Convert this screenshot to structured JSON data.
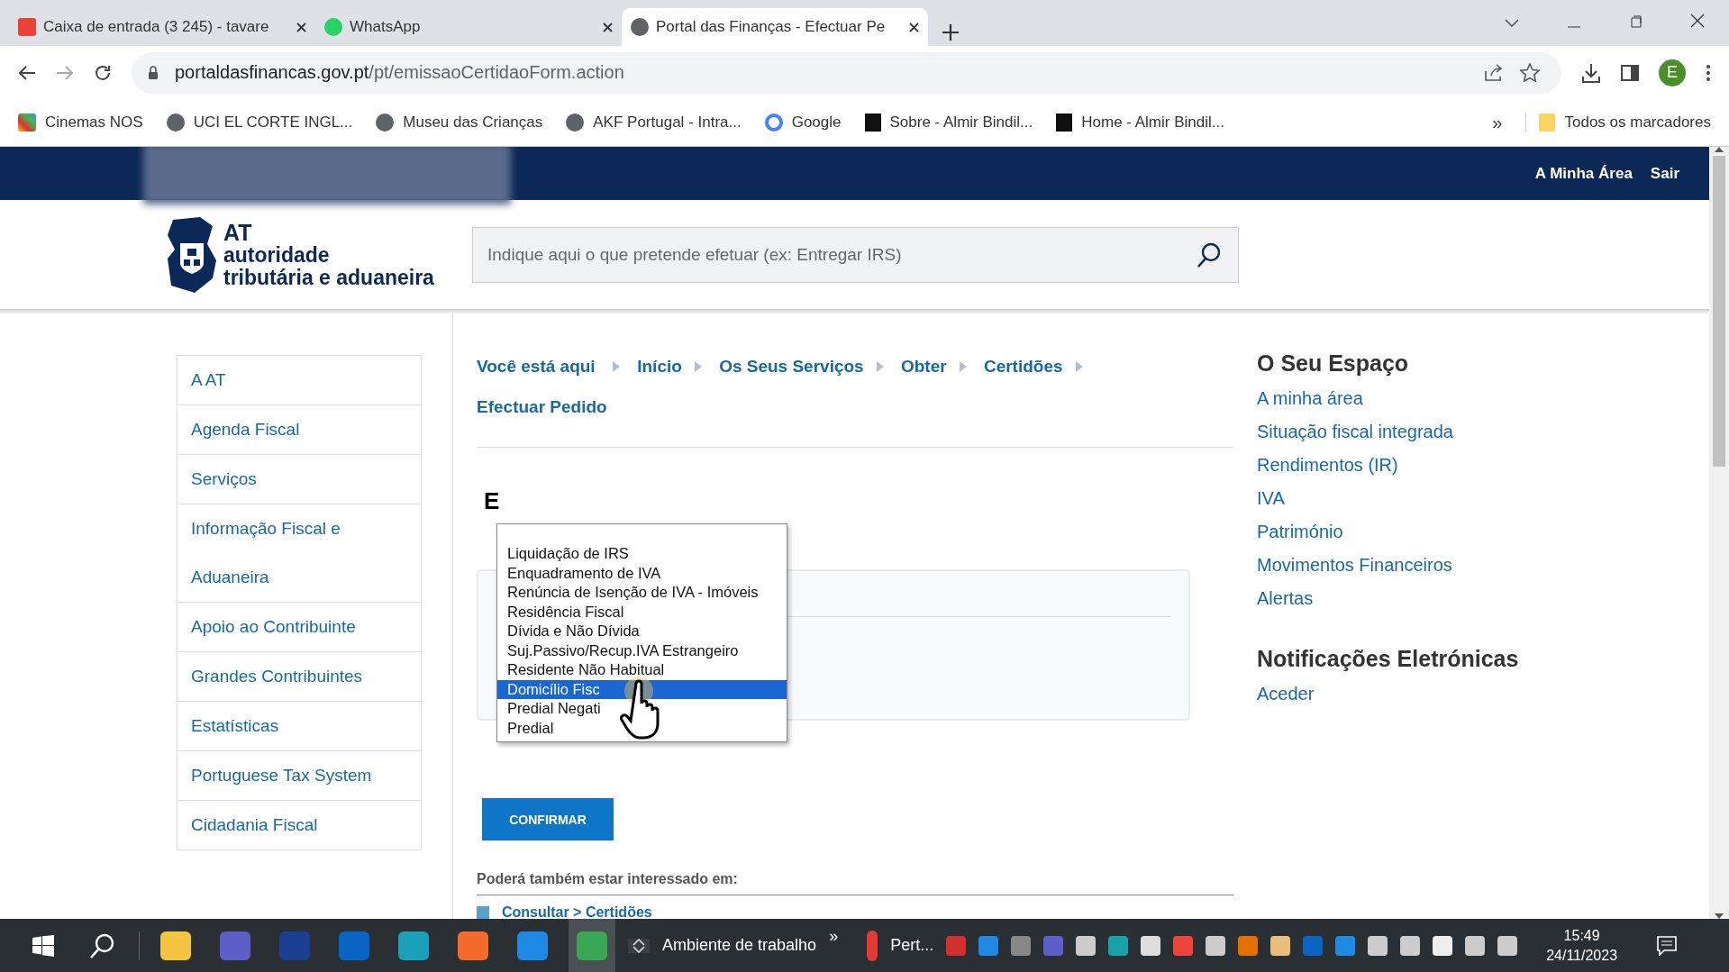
{
  "browser": {
    "tabs": [
      {
        "title": "Caixa de entrada (3 245) - tavare",
        "selected": false
      },
      {
        "title": "WhatsApp",
        "selected": false
      },
      {
        "title": "Portal das Finanças - Efectuar Pe",
        "selected": true
      }
    ],
    "address": {
      "domain": "portaldasfinancas.gov.pt",
      "path": "/pt/emissaoCertidaoForm.action"
    },
    "profile_initial": "E",
    "bookmarks": [
      "Cinemas NOS",
      "UCI EL CORTE INGL...",
      "Museu das Crianças",
      "AKF Portugal - Intra...",
      "Google",
      "Sobre - Almir Bindil...",
      "Home - Almir Bindil..."
    ],
    "bookmarks_more": "»",
    "all_bookmarks": "Todos os marcadores"
  },
  "header": {
    "links": [
      "A Minha Área",
      "Sair"
    ]
  },
  "logo": {
    "short": "AT",
    "line_1": "autoridade",
    "line_2": "tributária e aduaneira"
  },
  "search": {
    "placeholder": "Indique aqui o que pretende efetuar (ex: Entregar IRS)"
  },
  "sidebar": {
    "items": [
      "A AT",
      "Agenda Fiscal",
      "Serviços",
      "Informação Fiscal e Aduaneira",
      "Apoio ao Contribuinte",
      "Grandes Contribuintes",
      "Estatísticas",
      "Portuguese Tax System",
      "Cidadania Fiscal"
    ]
  },
  "breadcrumb": {
    "label": "Você está aqui",
    "items": [
      "Início",
      "Os Seus Serviços",
      "Obter",
      "Certidões",
      "Efectuar Pedido"
    ]
  },
  "form": {
    "heading": "E",
    "options": [
      {
        "label": "Liquidação de IRS",
        "selected": false
      },
      {
        "label": "Enquadramento de IVA",
        "selected": false
      },
      {
        "label": "Renúncia de Isenção de IVA - Imóveis",
        "selected": false
      },
      {
        "label": "Residência Fiscal",
        "selected": false
      },
      {
        "label": "Dívida e Não Dívida",
        "selected": false
      },
      {
        "label": "Suj.Passivo/Recup.IVA Estrangeiro",
        "selected": false
      },
      {
        "label": "Residente Não Habitual",
        "selected": false
      },
      {
        "label": "Domicílio Fisc",
        "selected": true
      },
      {
        "label": "Predial Negati",
        "selected": false
      },
      {
        "label": "Predial",
        "selected": false
      }
    ],
    "button": "CONFIRMAR"
  },
  "related": {
    "title": "Poderá também estar interessado em:",
    "links": [
      "Consultar > Certidões"
    ]
  },
  "right": {
    "sections": [
      {
        "title": "O Seu Espaço",
        "links": [
          "A minha área",
          "Situação fiscal integrada",
          "Rendimentos (IR)",
          "IVA",
          "Património",
          "Movimentos Financeiros",
          "Alertas"
        ]
      },
      {
        "title": "Notificações Eletrónicas",
        "links": [
          "Aceder"
        ]
      }
    ]
  },
  "taskbar": {
    "desktop": "Ambiente de trabalho",
    "more": "»",
    "app": "Pert...",
    "time": "15:49",
    "date": "24/11/2023"
  }
}
